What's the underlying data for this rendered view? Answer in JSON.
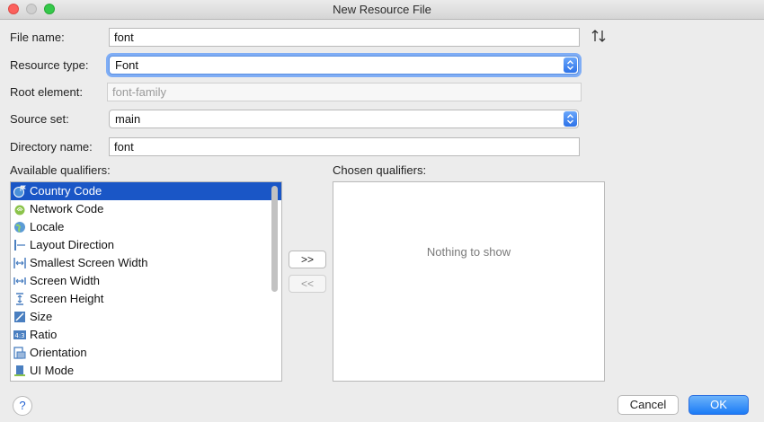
{
  "window": {
    "title": "New Resource File"
  },
  "form": {
    "file_name_label": "File name:",
    "file_name_value": "font",
    "resource_type_label": "Resource type:",
    "resource_type_value": "Font",
    "root_element_label": "Root element:",
    "root_element_value": "font-family",
    "source_set_label": "Source set:",
    "source_set_value": "main",
    "directory_name_label": "Directory name:",
    "directory_name_value": "font"
  },
  "qualifiers": {
    "available_label": "Available qualifiers:",
    "chosen_label": "Chosen qualifiers:",
    "empty_text": "Nothing to show",
    "items": [
      {
        "label": "Country Code",
        "icon": "globe-flag-icon",
        "selected": true
      },
      {
        "label": "Network Code",
        "icon": "network-icon"
      },
      {
        "label": "Locale",
        "icon": "globe-icon"
      },
      {
        "label": "Layout Direction",
        "icon": "layout-direction-icon"
      },
      {
        "label": "Smallest Screen Width",
        "icon": "smallest-width-icon"
      },
      {
        "label": "Screen Width",
        "icon": "width-icon"
      },
      {
        "label": "Screen Height",
        "icon": "height-icon"
      },
      {
        "label": "Size",
        "icon": "size-icon"
      },
      {
        "label": "Ratio",
        "icon": "ratio-icon"
      },
      {
        "label": "Orientation",
        "icon": "orientation-icon"
      },
      {
        "label": "UI Mode",
        "icon": "ui-mode-icon"
      }
    ],
    "add_label": ">>",
    "remove_label": "<<"
  },
  "footer": {
    "help_label": "?",
    "cancel_label": "Cancel",
    "ok_label": "OK"
  },
  "colors": {
    "selection": "#1a56c6",
    "accent": "#1b7bf6",
    "focus_ring": "#7fadf5"
  }
}
